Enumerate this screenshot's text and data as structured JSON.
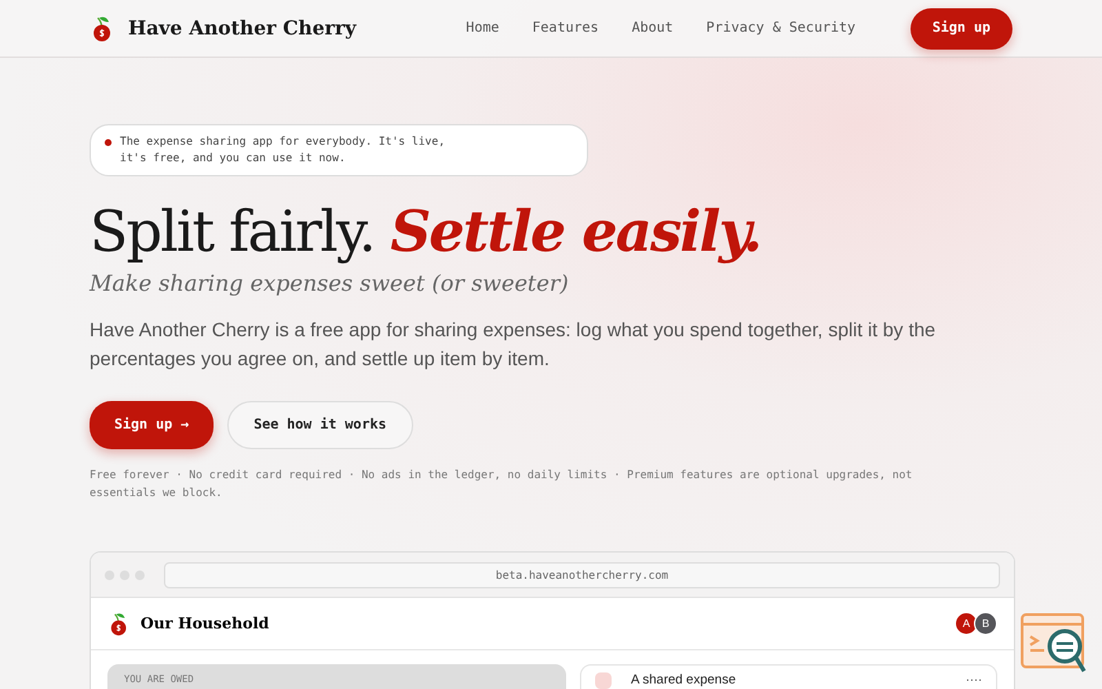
{
  "nav": {
    "brand": "Have Another Cherry",
    "links": [
      "Home",
      "Features",
      "About",
      "Privacy & Security"
    ],
    "cta": "Sign up"
  },
  "hero": {
    "badge": "The expense sharing app for everybody. It's live, it's free, and you can use it now.",
    "title_plain": "Split fairly.",
    "title_accent": "Settle easily.",
    "subtitle": "Make sharing expenses sweet (or sweeter)",
    "description": "Have Another Cherry is a free app for sharing expenses: log what you spend together, split it by the percentages you agree on, and settle up item by item.",
    "primary_button": "Sign up →",
    "secondary_button": "See how it works",
    "footnote": "Free forever · No credit card required · No ads in the ledger, no daily limits · Premium features are optional upgrades, not essentials we block."
  },
  "preview": {
    "url": "beta.haveanothercherry.com",
    "group": "Our Household",
    "members": [
      {
        "initial": "A",
        "color": "#c0150a"
      },
      {
        "initial": "B",
        "color": "#55555a"
      }
    ],
    "owed_label": "YOU ARE OWED",
    "expense_title": "A shared expense",
    "menu": "····"
  }
}
